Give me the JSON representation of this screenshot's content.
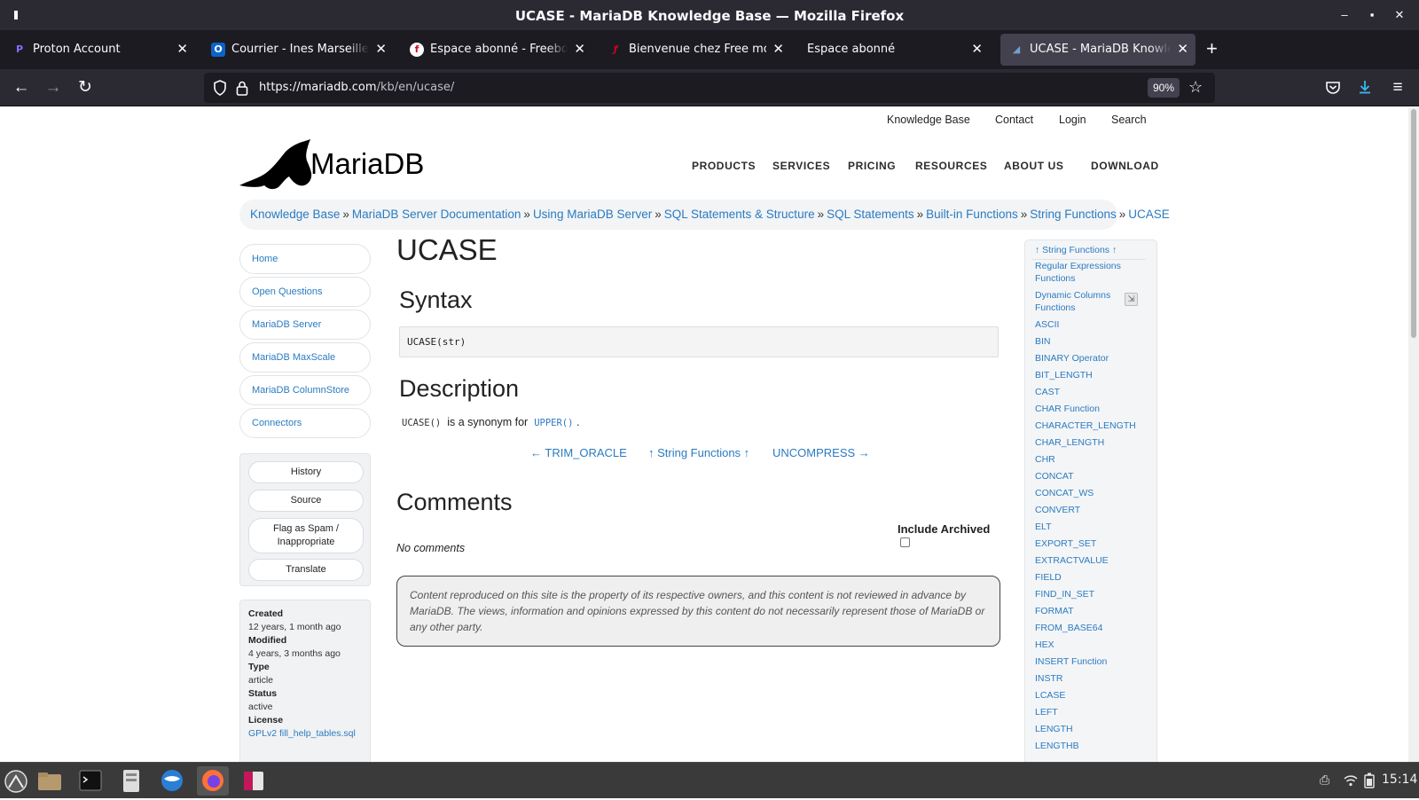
{
  "window": {
    "title": "UCASE - MariaDB Knowledge Base — Mozilla Firefox"
  },
  "tabs": [
    {
      "label": "Proton Account",
      "icon": "proton-icon"
    },
    {
      "label": "Courrier - Ines Marseille - Ou",
      "icon": "outlook-icon"
    },
    {
      "label": "Espace abonné - Freebox, la",
      "icon": "freebox-icon"
    },
    {
      "label": "Bienvenue chez Free mobile",
      "icon": "free-mobile-icon"
    },
    {
      "label": "Espace abonné",
      "icon": ""
    },
    {
      "label": "UCASE - MariaDB Knowledge",
      "icon": "mariadb-icon"
    }
  ],
  "urlbar": {
    "host": "https://mariadb.com",
    "path": "/kb/en/ucase/",
    "zoom": "90%"
  },
  "site": {
    "toplinks": [
      "Knowledge Base",
      "Contact",
      "Login",
      "Search"
    ],
    "logo_text": "MariaDB",
    "nav": [
      "PRODUCTS",
      "SERVICES",
      "PRICING",
      "RESOURCES",
      "ABOUT US",
      "DOWNLOAD"
    ],
    "breadcrumb": [
      "Knowledge Base",
      "MariaDB Server Documentation",
      "Using MariaDB Server",
      "SQL Statements & Structure",
      "SQL Statements",
      "Built-in Functions",
      "String Functions",
      "UCASE"
    ],
    "breadcrumb_sep": "»"
  },
  "left_nav": [
    "Home",
    "Open Questions",
    "MariaDB Server",
    "MariaDB MaxScale",
    "MariaDB ColumnStore",
    "Connectors"
  ],
  "actions": {
    "history": "History",
    "source": "Source",
    "flag_line1": "Flag as Spam /",
    "flag_line2": "Inappropriate",
    "translate": "Translate"
  },
  "meta": {
    "created_label": "Created",
    "created": "12 years, 1 month ago",
    "modified_label": "Modified",
    "modified": "4 years, 3 months ago",
    "type_label": "Type",
    "type": "article",
    "status_label": "Status",
    "status": "active",
    "license_label": "License",
    "license": "GPLv2 fill_help_tables.sql"
  },
  "article": {
    "title": "UCASE",
    "syntax_heading": "Syntax",
    "syntax_code": "UCASE(str)",
    "description_heading": "Description",
    "desc_code1": "UCASE()",
    "desc_text": "is a synonym for",
    "desc_code2": "UPPER()",
    "desc_end": ".",
    "prev": "← TRIM_ORACLE",
    "up": "↑ String Functions ↑",
    "next": "UNCOMPRESS →",
    "comments_heading": "Comments",
    "include_archived": "Include Archived",
    "no_comments": "No comments",
    "disclaimer": "Content reproduced on this site is the property of its respective owners, and this content is not reviewed in advance by MariaDB. The views, information and opinions expressed by this content do not necessarily represent those of MariaDB or any other party."
  },
  "right_nav": {
    "head": "↑ String Functions ↑",
    "items": [
      "Regular Expressions Functions",
      "Dynamic Columns Functions",
      "ASCII",
      "BIN",
      "BINARY Operator",
      "BIT_LENGTH",
      "CAST",
      "CHAR Function",
      "CHARACTER_LENGTH",
      "CHAR_LENGTH",
      "CHR",
      "CONCAT",
      "CONCAT_WS",
      "CONVERT",
      "ELT",
      "EXPORT_SET",
      "EXTRACTVALUE",
      "FIELD",
      "FIND_IN_SET",
      "FORMAT",
      "FROM_BASE64",
      "HEX",
      "INSERT Function",
      "INSTR",
      "LCASE",
      "LEFT",
      "LENGTH",
      "LENGTHB"
    ]
  },
  "taskbar": {
    "clock": "15:14"
  }
}
